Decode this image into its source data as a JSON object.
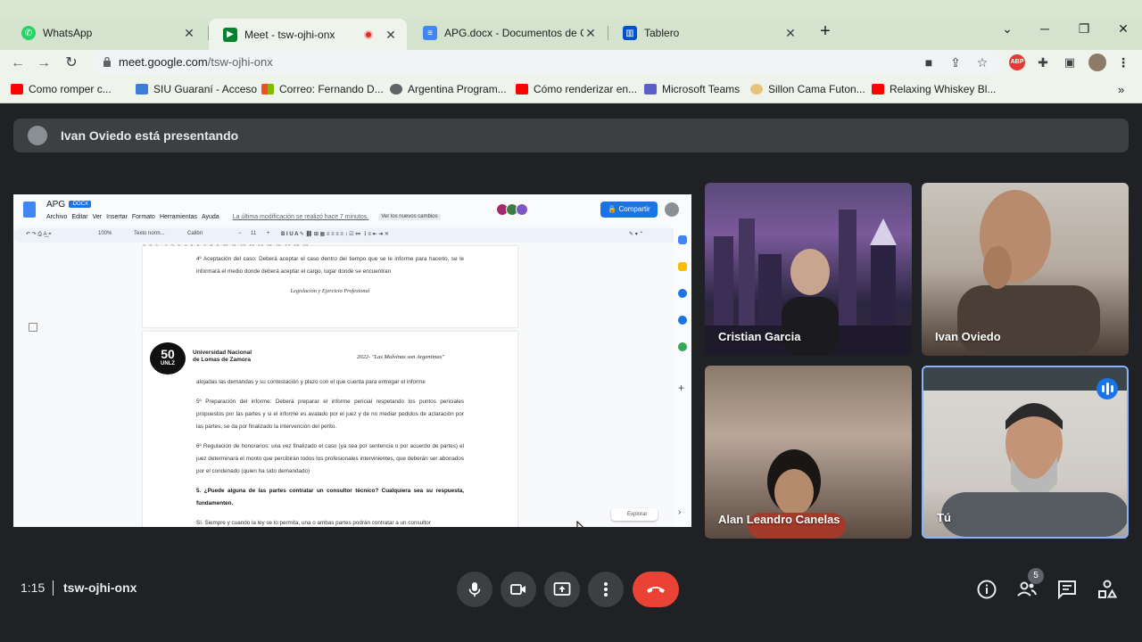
{
  "browser": {
    "tabs": [
      {
        "title": "WhatsApp",
        "icon": "whatsapp-icon"
      },
      {
        "title": "Meet - tsw-ojhi-onx",
        "icon": "meet-icon",
        "recording": true
      },
      {
        "title": "APG.docx - Documentos de Goo",
        "icon": "docs-icon"
      },
      {
        "title": "Tablero",
        "icon": "trello-icon"
      }
    ],
    "url_host": "meet.google.com",
    "url_path": "/tsw-ojhi-onx",
    "bookmarks": [
      "Como romper c...",
      "SIU Guaraní - Acceso",
      "Correo: Fernando D...",
      "Argentina Program...",
      "Cómo renderizar en...",
      "Microsoft Teams",
      "Sillon Cama Futon...",
      "Relaxing Whiskey Bl..."
    ],
    "extension_badge": "ABP"
  },
  "meet": {
    "presenting_text": "Ivan Oviedo está presentando",
    "meeting_time": "1:15",
    "meeting_code": "tsw-ojhi-onx",
    "participants_count": "5",
    "participants": [
      {
        "name": "Cristian Garcia"
      },
      {
        "name": "Ivan Oviedo"
      },
      {
        "name": "Alan Leandro Canelas"
      },
      {
        "name": "Tú"
      }
    ]
  },
  "doc": {
    "title": "APG",
    "badge": ".DOCX",
    "menu": [
      "Archivo",
      "Editar",
      "Ver",
      "Insertar",
      "Formato",
      "Herramientas",
      "Ayuda"
    ],
    "last_modified": "La última modificación se realizó hace 7 minutos.",
    "new_changes": "Ver los nuevos cambios",
    "share_label": "Compartir",
    "zoom": "100%",
    "style": "Texto norm...",
    "font": "Calibri",
    "font_size": "11",
    "explore_label": "Explorar",
    "page1": {
      "p1": "4º Aceptación del caso: Deberá aceptar el caso dentro del tiempo que se le informe para hacerlo, se le informará el medio donde deberá aceptar el cargo, lugar donde se encuentran",
      "footer": "Legislación y Ejercicio Profesional"
    },
    "page2": {
      "logo_number": "50",
      "logo_text": "UNLZ",
      "univ_line1": "Universidad Nacional",
      "univ_line2": "de Lomas de Zamora",
      "motto": "2022- \"Las Malvinas son Argentinas\"",
      "p1": "alojadas las demandas y su contestación y plazo con el que cuenta para entregar el informe",
      "p2": "5º Preparación del informe: Deberá preparar el informe pericial respetando los puntos periciales propuestos por las partes y si el informe es avalado por el juez y de no mediar pedidos de aclaración por las partes, se da por finalizado la intervención del perito.",
      "p3": "6º Regulación de honorarios: una vez finalizado el caso (ya sea por sentencia o por acuerdo de partes) el juez determinará el monto que percibirán todos los profesionales intervinientes, que deberán ser abonados por el condenado (quien ha sido demandado)",
      "q5": "5. ¿Puede alguna de las partes contratar un consultor técnico? Cualquiera sea su respuesta, fundamenten.",
      "a5": "Sí. Siempre y cuando la ley se lo permita, una o ambas partes podrán contratar a un consultor"
    }
  },
  "colors": {
    "meet_bg": "#202124",
    "end_call": "#ea4335",
    "accent": "#1a73e8"
  }
}
